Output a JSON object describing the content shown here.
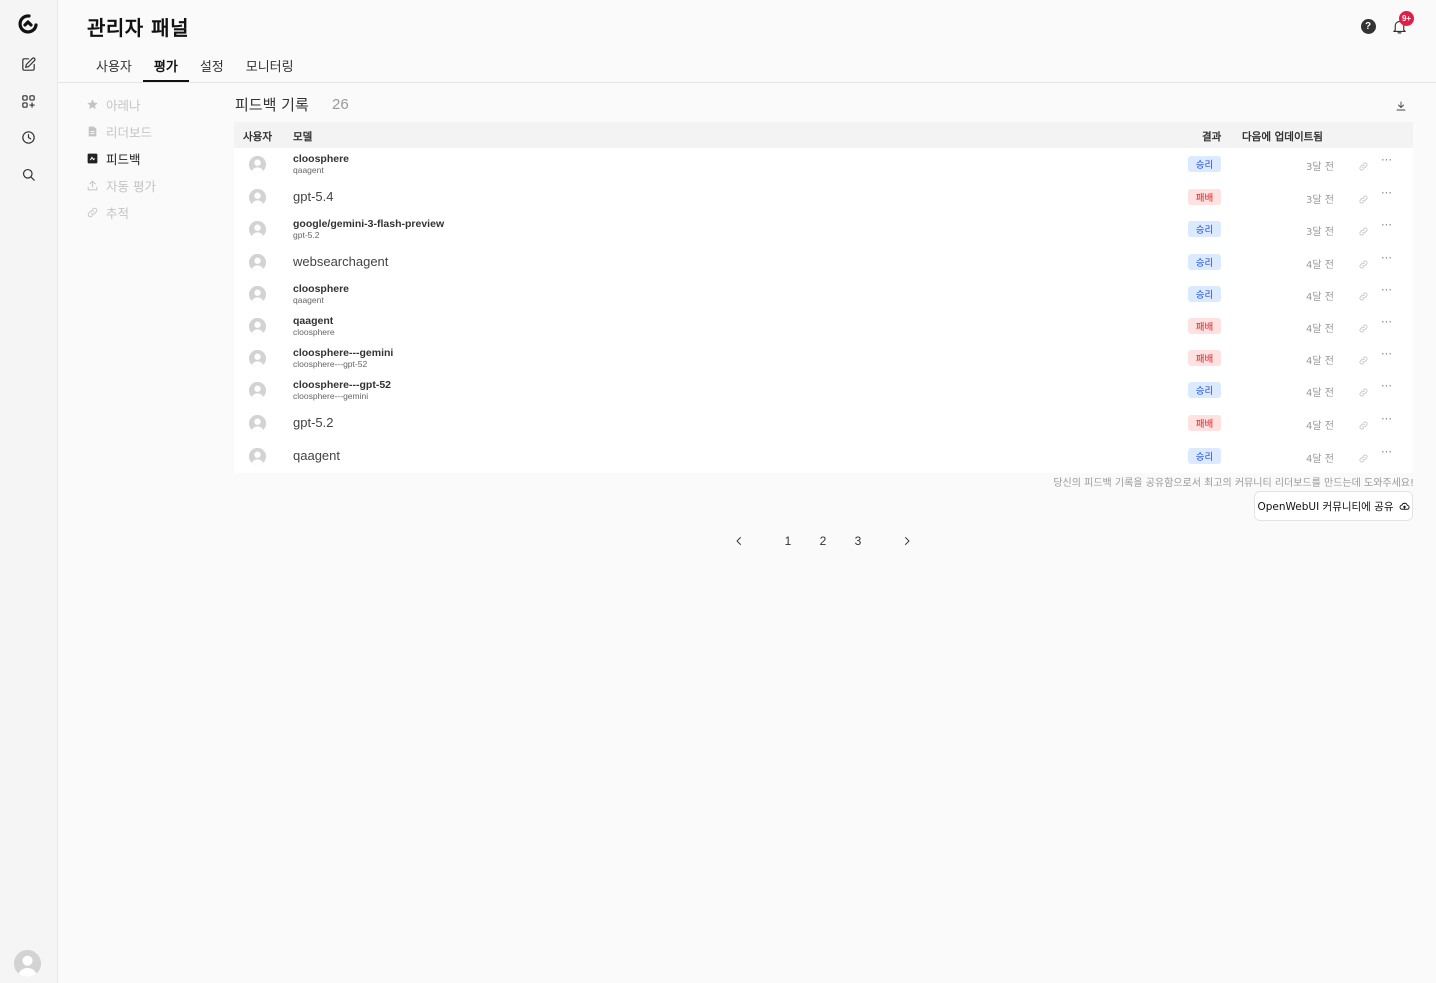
{
  "header": {
    "title": "관리자 패널",
    "notification_badge": "9+"
  },
  "tabs": [
    {
      "label": "사용자",
      "active": false
    },
    {
      "label": "평가",
      "active": true
    },
    {
      "label": "설정",
      "active": false
    },
    {
      "label": "모니터링",
      "active": false
    }
  ],
  "subnav": [
    {
      "label": "아레나",
      "icon": "star-icon",
      "active": false
    },
    {
      "label": "리더보드",
      "icon": "document-icon",
      "active": false
    },
    {
      "label": "피드백",
      "icon": "feedback-icon",
      "active": true
    },
    {
      "label": "자동 평가",
      "icon": "upload-icon",
      "active": false
    },
    {
      "label": "추적",
      "icon": "link-icon",
      "active": false
    }
  ],
  "feedback": {
    "title": "피드백 기록",
    "count": "26",
    "columns": {
      "user": "사용자",
      "model": "모델",
      "result": "결과",
      "updated": "다음에 업데이트됨"
    },
    "rows": [
      {
        "model": "cloosphere",
        "sub": "qaagent",
        "result": "승리",
        "type": "win",
        "updated": "3달 전"
      },
      {
        "model": "gpt-5.4",
        "sub": "",
        "result": "패배",
        "type": "lose",
        "updated": "3달 전"
      },
      {
        "model": "google/gemini-3-flash-preview",
        "sub": "gpt-5.2",
        "result": "승리",
        "type": "win",
        "updated": "3달 전"
      },
      {
        "model": "websearchagent",
        "sub": "",
        "result": "승리",
        "type": "win",
        "updated": "4달 전"
      },
      {
        "model": "cloosphere",
        "sub": "qaagent",
        "result": "승리",
        "type": "win",
        "updated": "4달 전"
      },
      {
        "model": "qaagent",
        "sub": "cloosphere",
        "result": "패배",
        "type": "lose",
        "updated": "4달 전"
      },
      {
        "model": "cloosphere---gemini",
        "sub": "cloosphere---gpt-52",
        "result": "패배",
        "type": "lose",
        "updated": "4달 전"
      },
      {
        "model": "cloosphere---gpt-52",
        "sub": "cloosphere---gemini",
        "result": "승리",
        "type": "win",
        "updated": "4달 전"
      },
      {
        "model": "gpt-5.2",
        "sub": "",
        "result": "패배",
        "type": "lose",
        "updated": "4달 전"
      },
      {
        "model": "qaagent",
        "sub": "",
        "result": "승리",
        "type": "win",
        "updated": "4달 전"
      }
    ],
    "share_text": "당신의 피드백 기록을 공유함으로서 최고의 커뮤니티 리더보드를 만드는데 도와주세요!",
    "share_button": "OpenWebUI 커뮤니티에 공유"
  },
  "pagination": {
    "pages": [
      "1",
      "2",
      "3"
    ],
    "current": "2"
  },
  "colors": {
    "win_bg": "#dbeafe",
    "win_fg": "#1d4ed8",
    "lose_bg": "#fee2e2",
    "lose_fg": "#dc2626",
    "badge": "#e11d48"
  }
}
